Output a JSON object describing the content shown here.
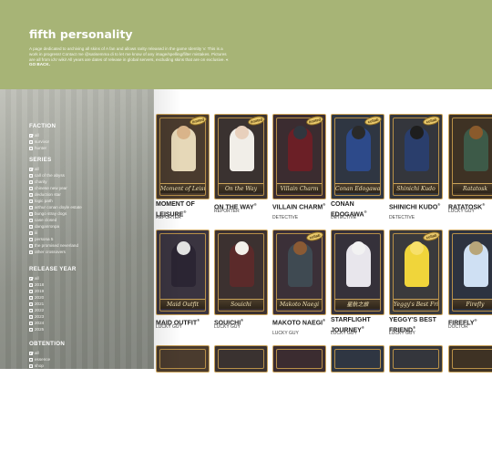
{
  "site": {
    "title": "fifth personality",
    "description": "A page dedicated to archiving all skins of A fan and allows rarity released in the game Identity V. This is a work in progress! Contact me @satisemma di to let me know of any image/spelling/filter mistakes. Pictures are all from idV wiki! All years are dates of release in global servers, excluding skins that are on exclusive.",
    "go_back": "« GO BACK."
  },
  "filters": [
    {
      "heading": "FACTION",
      "items": [
        {
          "label": "all",
          "checked": true
        },
        {
          "label": "survivor",
          "checked": false
        },
        {
          "label": "hunter",
          "checked": false
        }
      ]
    },
    {
      "heading": "SERIES",
      "items": [
        {
          "label": "all",
          "checked": true
        },
        {
          "label": "call of the abyss",
          "checked": false
        },
        {
          "label": "charity",
          "checked": false
        },
        {
          "label": "chinese new year",
          "checked": false
        },
        {
          "label": "deduction star",
          "checked": false
        },
        {
          "label": "logic path",
          "checked": false
        },
        {
          "label": "arthur conan doyle estate",
          "checked": false
        },
        {
          "label": "bungo stray dogs",
          "checked": false
        },
        {
          "label": "case closed",
          "checked": false
        },
        {
          "label": "danganronpa",
          "checked": false
        },
        {
          "label": "iii",
          "checked": false
        },
        {
          "label": "persona 5",
          "checked": false
        },
        {
          "label": "the promised neverland",
          "checked": false
        },
        {
          "label": "other crossovers",
          "checked": false
        }
      ]
    },
    {
      "heading": "RELEASE YEAR",
      "items": [
        {
          "label": "all",
          "checked": true
        },
        {
          "label": "2018",
          "checked": false
        },
        {
          "label": "2019",
          "checked": false
        },
        {
          "label": "2020",
          "checked": false
        },
        {
          "label": "2021",
          "checked": false
        },
        {
          "label": "2022",
          "checked": false
        },
        {
          "label": "2023",
          "checked": false
        },
        {
          "label": "2024",
          "checked": false
        },
        {
          "label": "2025",
          "checked": false
        }
      ]
    },
    {
      "heading": "OBTENTION",
      "items": [
        {
          "label": "all",
          "checked": true
        },
        {
          "label": "essence",
          "checked": false
        },
        {
          "label": "shop",
          "checked": false
        }
      ]
    }
  ],
  "cards": [
    {
      "name": "MOMENT OF LEISURE",
      "role": "REPORTER",
      "banner": "Moment of Leisure",
      "badge": "limited",
      "bg": "#4a3b2e",
      "body": "#e6d8b8",
      "skin": "#d9b48a"
    },
    {
      "name": "ON THE WAY",
      "role": "REPORTER",
      "banner": "On the Way",
      "badge": "limited",
      "bg": "#3a3230",
      "body": "#f1eee8",
      "skin": "#e8d0bc"
    },
    {
      "name": "VILLAIN CHARM",
      "role": "DETECTIVE",
      "banner": "Villain Charm",
      "badge": "limited",
      "bg": "#3b2c30",
      "body": "#6b1f26",
      "skin": "#31363e"
    },
    {
      "name": "CONAN EDOGAWA",
      "role": "DETECTIVE",
      "banner": "Conan Edogawa",
      "badge": "collab",
      "bg": "#2f3642",
      "body": "#2d4a8a",
      "skin": "#2a2a2a"
    },
    {
      "name": "SHINICHI KUDO",
      "role": "DETECTIVE",
      "banner": "Shinichi Kudo",
      "badge": "collab",
      "bg": "#34363c",
      "body": "#2a3e6c",
      "skin": "#1e1e1e"
    },
    {
      "name": "RATATOSK",
      "role": "LUCKY GUY",
      "banner": "Ratatosk",
      "badge": "",
      "bg": "#3e3224",
      "body": "#3d5a48",
      "skin": "#8a5a2c"
    },
    {
      "name": "MAID OUTFIT",
      "role": "LUCKY GUY",
      "banner": "Maid Outfit",
      "badge": "",
      "bg": "#3a3440",
      "body": "#2b2533",
      "skin": "#e2e2e2"
    },
    {
      "name": "SOUICHI",
      "role": "LUCKY GUY",
      "banner": "Souichi",
      "badge": "",
      "bg": "#3c3130",
      "body": "#5b2a2a",
      "skin": "#f3f0ea"
    },
    {
      "name": "MAKOTO NAEGI",
      "role": "LUCKY GUY",
      "banner": "Makoto Naegi",
      "badge": "collab",
      "bg": "#3b3038",
      "body": "#3f4a52",
      "skin": "#8a5a34"
    },
    {
      "name": "STARFLIGHT JOURNEY",
      "role": "LUCKY GUY",
      "banner": "星航之旅",
      "badge": "",
      "bg": "#35313a",
      "body": "#e8e6ec",
      "skin": "#f2f2f2"
    },
    {
      "name": "YEGGY'S BEST FRIEND",
      "role": "LUCKY GUY",
      "banner": "Yeggy's Best Friend",
      "badge": "collab",
      "bg": "#3a3a3c",
      "body": "#f0d53a",
      "skin": "#f7e06a"
    },
    {
      "name": "FIREFLY",
      "role": "DOCTOR",
      "banner": "Firefly",
      "badge": "",
      "bg": "#2d3340",
      "body": "#cfe0f3",
      "skin": "#b8a67a"
    }
  ]
}
